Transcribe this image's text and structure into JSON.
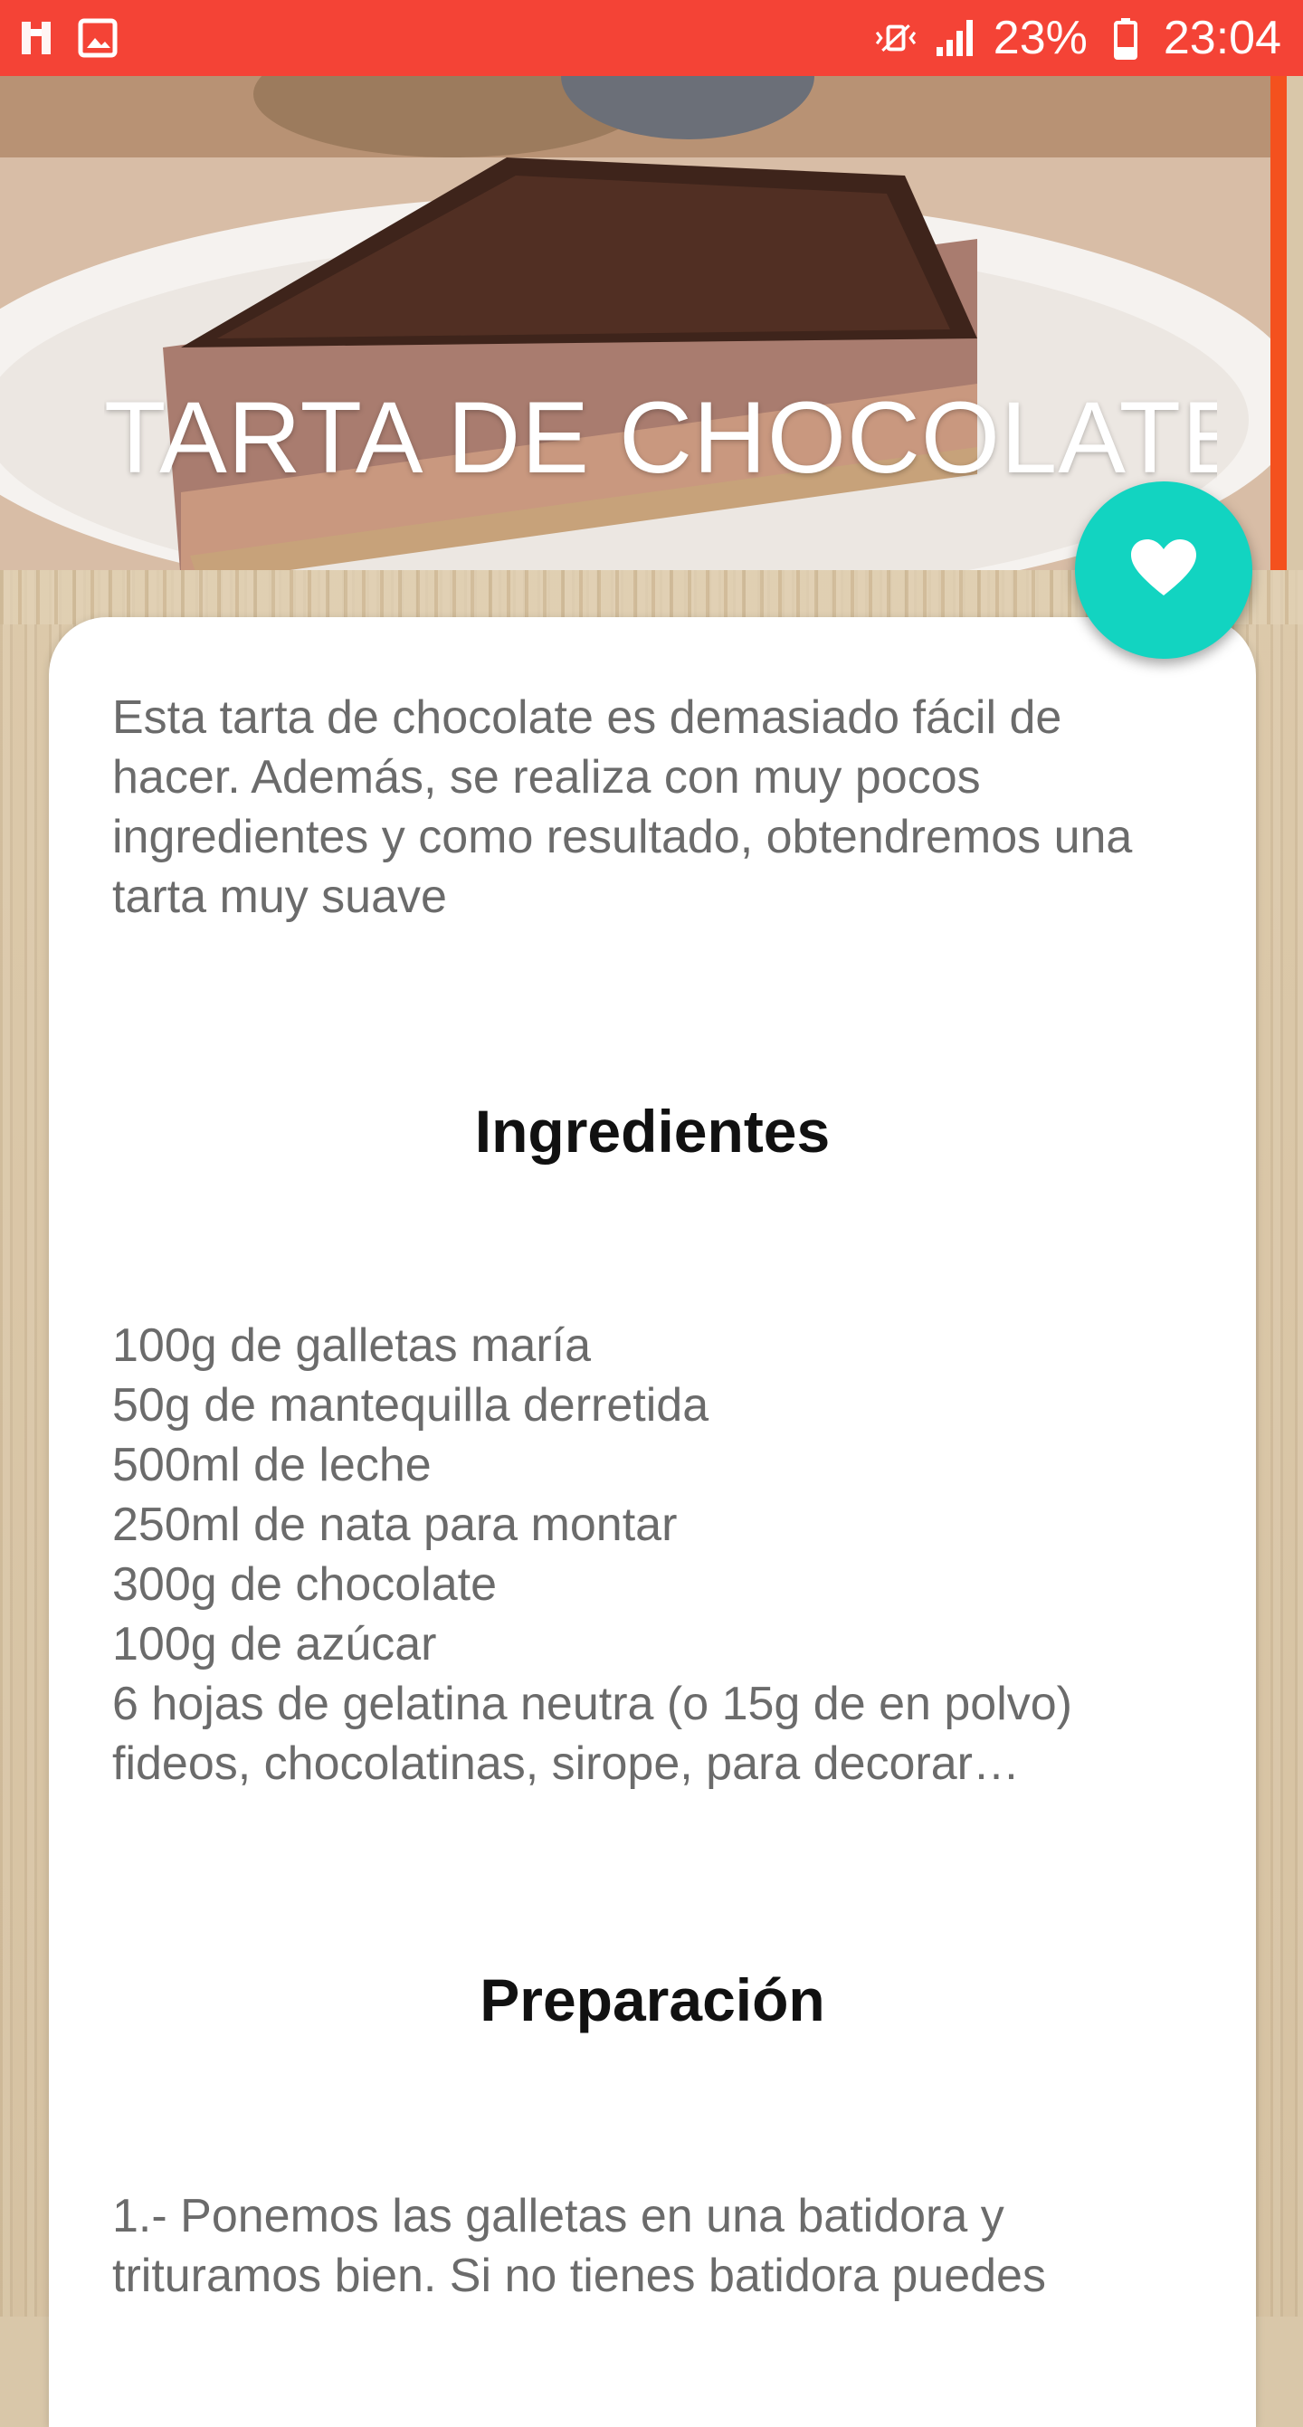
{
  "status_bar": {
    "battery": "23%",
    "time": "23:04"
  },
  "recipe": {
    "title": "TARTA DE CHOCOLATE",
    "description": "Esta tarta de chocolate es demasiado fácil de hacer. Además, se realiza con muy pocos ingredientes y como resultado, obtendremos una tarta muy suave",
    "ingredients_heading": "Ingredientes",
    "ingredients": [
      "100g de galletas maría",
      "50g de mantequilla derretida",
      "500ml de leche",
      "250ml de nata para montar",
      "300g de chocolate",
      "100g de azúcar",
      "6 hojas de gelatina neutra (o 15g de en polvo)",
      "fideos, chocolatinas, sirope, para decorar…"
    ],
    "preparation_heading": "Preparación",
    "preparation": "1.- Ponemos las galletas en una batidora y trituramos bien. Si no tienes batidora puedes"
  },
  "colors": {
    "status_bar": "#f44336",
    "fab": "#12d4c1",
    "hero_accent": "#f4511e"
  },
  "icons": {
    "fab": "heart-icon",
    "status_left": [
      "notification-icon",
      "image-icon"
    ],
    "status_right": [
      "vibrate-icon",
      "signal-icon",
      "battery-icon"
    ]
  }
}
